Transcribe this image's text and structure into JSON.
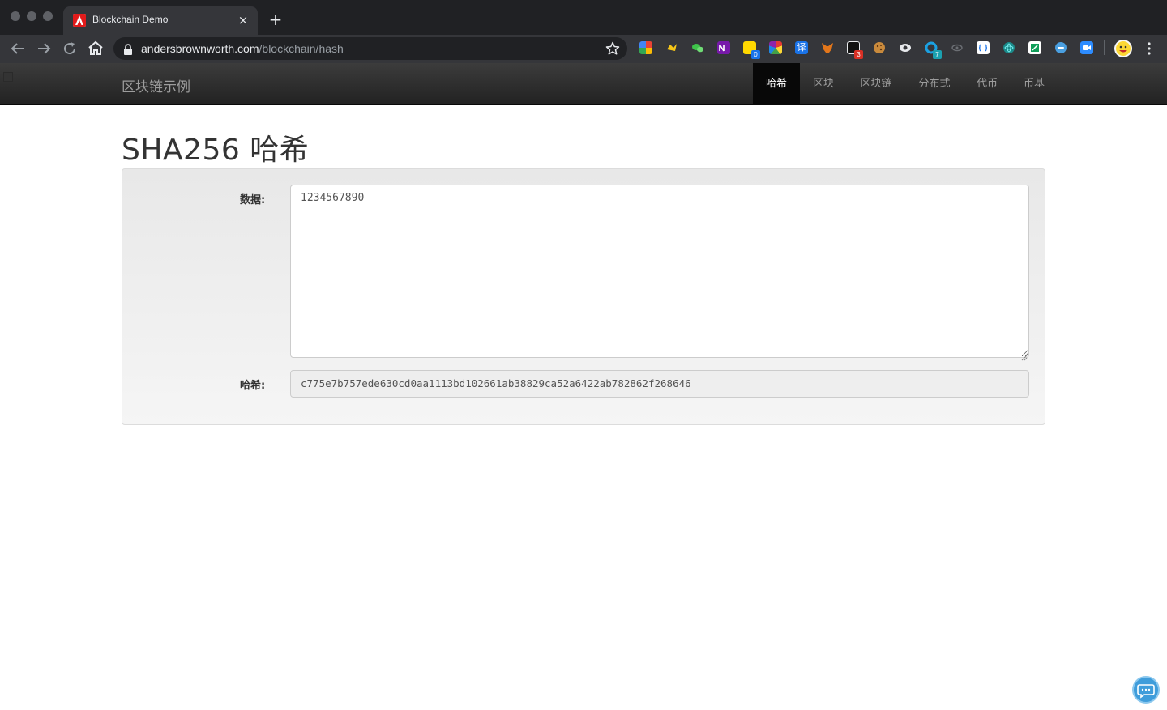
{
  "browser": {
    "tab_title": "Blockchain Demo",
    "tab_close": "×",
    "new_tab": "+",
    "url_host": "andersbrownworth.com",
    "url_path": "/blockchain/hash",
    "extension_badges": [
      "0",
      "3",
      "7"
    ]
  },
  "navbar": {
    "brand": "区块链示例",
    "items": [
      {
        "label": "哈希",
        "active": true
      },
      {
        "label": "区块",
        "active": false
      },
      {
        "label": "区块链",
        "active": false
      },
      {
        "label": "分布式",
        "active": false
      },
      {
        "label": "代币",
        "active": false
      },
      {
        "label": "币基",
        "active": false
      }
    ]
  },
  "page": {
    "title": "SHA256 哈希",
    "data_label": "数据:",
    "data_value": "1234567890",
    "hash_label": "哈希:",
    "hash_value": "c775e7b757ede630cd0aa1113bd102661ab38829ca52a6422ab782862f268646"
  },
  "colors": {
    "chrome_bg": "#35363a",
    "navbar_bg": "#222222",
    "active_nav_bg": "#080808",
    "well_bg": "#f5f5f5",
    "chat_button": "#3f9ddb"
  },
  "icons": [
    "adobe-icon",
    "back-arrow-icon",
    "forward-arrow-icon",
    "reload-icon",
    "home-icon",
    "lock-icon",
    "star-icon",
    "kebab-menu-icon",
    "chat-icon"
  ]
}
